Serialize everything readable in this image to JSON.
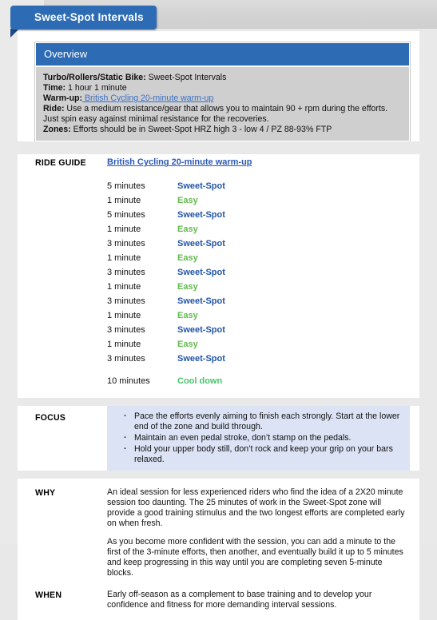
{
  "tab": {
    "title": "Sweet-Spot Intervals"
  },
  "overview": {
    "heading": "Overview",
    "rows": [
      {
        "label": "Turbo/Rollers/Static Bike:",
        "value": " Sweet-Spot Intervals"
      },
      {
        "label": "Time:",
        "value": " 1 hour 1 minute"
      },
      {
        "label": "Warm-up:",
        "link": " British Cycling 20-minute warm-up"
      },
      {
        "label": "Ride:",
        "value": " Use a medium resistance/gear that allows you to maintain 90 + rpm during the efforts. Just spin easy against minimal resistance for the recoveries."
      },
      {
        "label": "Zones:",
        "value": " Efforts should be in Sweet-Spot HRZ high 3 - low 4 / PZ 88-93% FTP"
      }
    ]
  },
  "ride_guide": {
    "label": "RIDE GUIDE",
    "link": "British Cycling 20-minute warm-up",
    "intervals": [
      {
        "duration": "5 minutes",
        "zone": "Sweet-Spot",
        "zone_type": "sweet"
      },
      {
        "duration": "1 minute",
        "zone": "Easy",
        "zone_type": "easy"
      },
      {
        "duration": "5 minutes",
        "zone": "Sweet-Spot",
        "zone_type": "sweet"
      },
      {
        "duration": "1 minute",
        "zone": "Easy",
        "zone_type": "easy"
      },
      {
        "duration": "3 minutes",
        "zone": "Sweet-Spot",
        "zone_type": "sweet"
      },
      {
        "duration": "1 minute",
        "zone": "Easy",
        "zone_type": "easy"
      },
      {
        "duration": "3 minutes",
        "zone": "Sweet-Spot",
        "zone_type": "sweet"
      },
      {
        "duration": "1 minute",
        "zone": "Easy",
        "zone_type": "easy"
      },
      {
        "duration": "3 minutes",
        "zone": "Sweet-Spot",
        "zone_type": "sweet"
      },
      {
        "duration": "1 minute",
        "zone": "Easy",
        "zone_type": "easy"
      },
      {
        "duration": "3 minutes",
        "zone": "Sweet-Spot",
        "zone_type": "sweet"
      },
      {
        "duration": "1 minute",
        "zone": "Easy",
        "zone_type": "easy"
      },
      {
        "duration": "3 minutes",
        "zone": "Sweet-Spot",
        "zone_type": "sweet"
      }
    ],
    "cool_down": {
      "duration": "10 minutes",
      "zone": "Cool down",
      "zone_type": "cool"
    }
  },
  "focus": {
    "label": "FOCUS",
    "bullets": [
      "Pace the efforts evenly aiming to finish each strongly. Start at the lower end of the zone and build through.",
      "Maintain an even pedal stroke, don’t stamp on the pedals.",
      "Hold your upper body still, don’t rock and keep your grip on your bars relaxed."
    ]
  },
  "why": {
    "label": "WHY",
    "paragraphs": [
      "An ideal session for less experienced riders who find the idea of a 2X20 minute session too daunting. The 25 minutes of work in the Sweet-Spot zone will provide a good training stimulus and the two longest efforts are completed early on when fresh.",
      "As you become more confident with the session, you can add a minute to the first of the 3-minute efforts, then another, and eventually build it up to 5 minutes and keep progressing in this way until you are completing seven 5-minute blocks."
    ]
  },
  "when": {
    "label": "WHEN",
    "text": "Early off-season as a complement to base training and to develop your confidence and fitness for more demanding interval sessions."
  },
  "colors": {
    "accent_blue": "#2d6cb5",
    "sweet_spot": "#2255aa",
    "easy_green": "#63b94f",
    "cool_green": "#49c46a",
    "link_blue": "#2a58b8",
    "focus_bg": "#dce3f5",
    "overview_body_bg": "#cfcfcf"
  }
}
